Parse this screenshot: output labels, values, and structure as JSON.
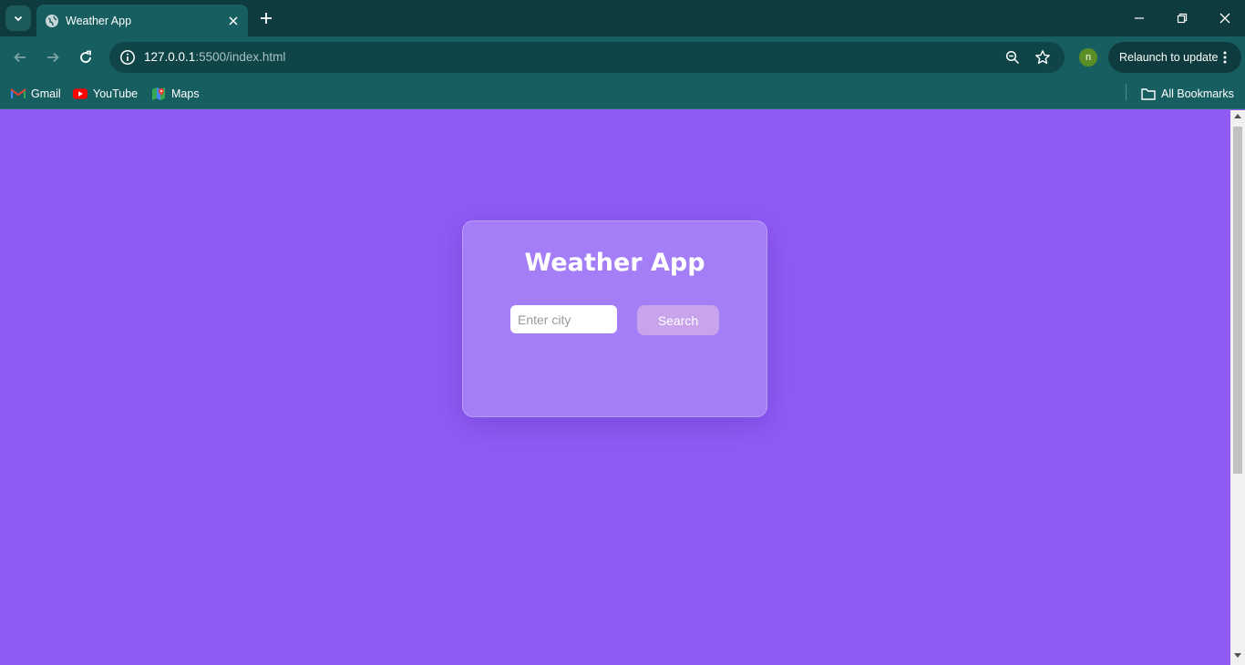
{
  "browser": {
    "tab": {
      "title": "Weather App"
    },
    "address": {
      "host": "127.0.0.1",
      "path": ":5500/index.html"
    },
    "profile_initial": "n",
    "relaunch_label": "Relaunch to update",
    "bookmarks": [
      {
        "label": "Gmail",
        "icon": "gmail-icon"
      },
      {
        "label": "YouTube",
        "icon": "youtube-icon"
      },
      {
        "label": "Maps",
        "icon": "maps-icon"
      }
    ],
    "all_bookmarks_label": "All Bookmarks"
  },
  "page": {
    "title": "Weather App",
    "city_input": {
      "value": "",
      "placeholder": "Enter city"
    },
    "search_label": "Search",
    "colors": {
      "background": "#8f5cf5",
      "card": "#a47ef6",
      "button": "#c9a3ec",
      "browser_frame": "#175e61"
    }
  }
}
